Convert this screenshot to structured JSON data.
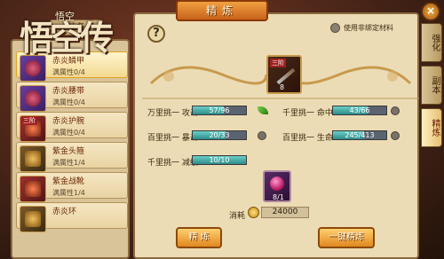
{
  "logo": {
    "main": "悟空传",
    "sub": "悟空"
  },
  "left_tab_header": "装备",
  "items": [
    {
      "name": "赤炎鳞甲",
      "sub": "满属性0/4",
      "badge": "",
      "style": "purple"
    },
    {
      "name": "赤炎腰带",
      "sub": "满属性0/4",
      "badge": "",
      "style": "purple"
    },
    {
      "name": "赤炎护腕",
      "sub": "满属性0/4",
      "badge": "三阶",
      "style": "red"
    },
    {
      "name": "紫金头箍",
      "sub": "满属性1/4",
      "badge": "",
      "style": "gold"
    },
    {
      "name": "紫金战靴",
      "sub": "满属性1/4",
      "badge": "",
      "style": "red"
    },
    {
      "name": "赤炎环",
      "sub": "",
      "badge": "",
      "style": "gold"
    }
  ],
  "title": "精炼",
  "help_label": "?",
  "use_unbound_label": "使用非绑定材料",
  "equip": {
    "tag": "三阶",
    "count": "8"
  },
  "stats": [
    {
      "label": "万里挑一 攻击",
      "value": "57/96",
      "fill": 0.59,
      "bonus": true
    },
    {
      "label": "千里挑一 命中",
      "value": "43/66",
      "fill": 0.65,
      "bonus": false
    },
    {
      "label": "百里挑一 暴击",
      "value": "20/33",
      "fill": 0.61,
      "bonus": false
    },
    {
      "label": "百里挑一 生命",
      "value": "245/413",
      "fill": 0.59,
      "bonus": false
    },
    {
      "label": "千里挑一 减级",
      "value": "10/10",
      "fill": 1.0,
      "bonus": false
    }
  ],
  "gem": {
    "count": "8/1"
  },
  "cost_label": "消耗",
  "cost_value": "24000",
  "buttons": {
    "refine": "精 炼",
    "one_key": "一键精炼"
  },
  "right_tabs": [
    "强化",
    "副本",
    "精炼"
  ],
  "close_label": "×",
  "colors": {
    "accent": "#e08820",
    "bar_fill": "#2e8a88",
    "panel": "#ecdcb6"
  }
}
